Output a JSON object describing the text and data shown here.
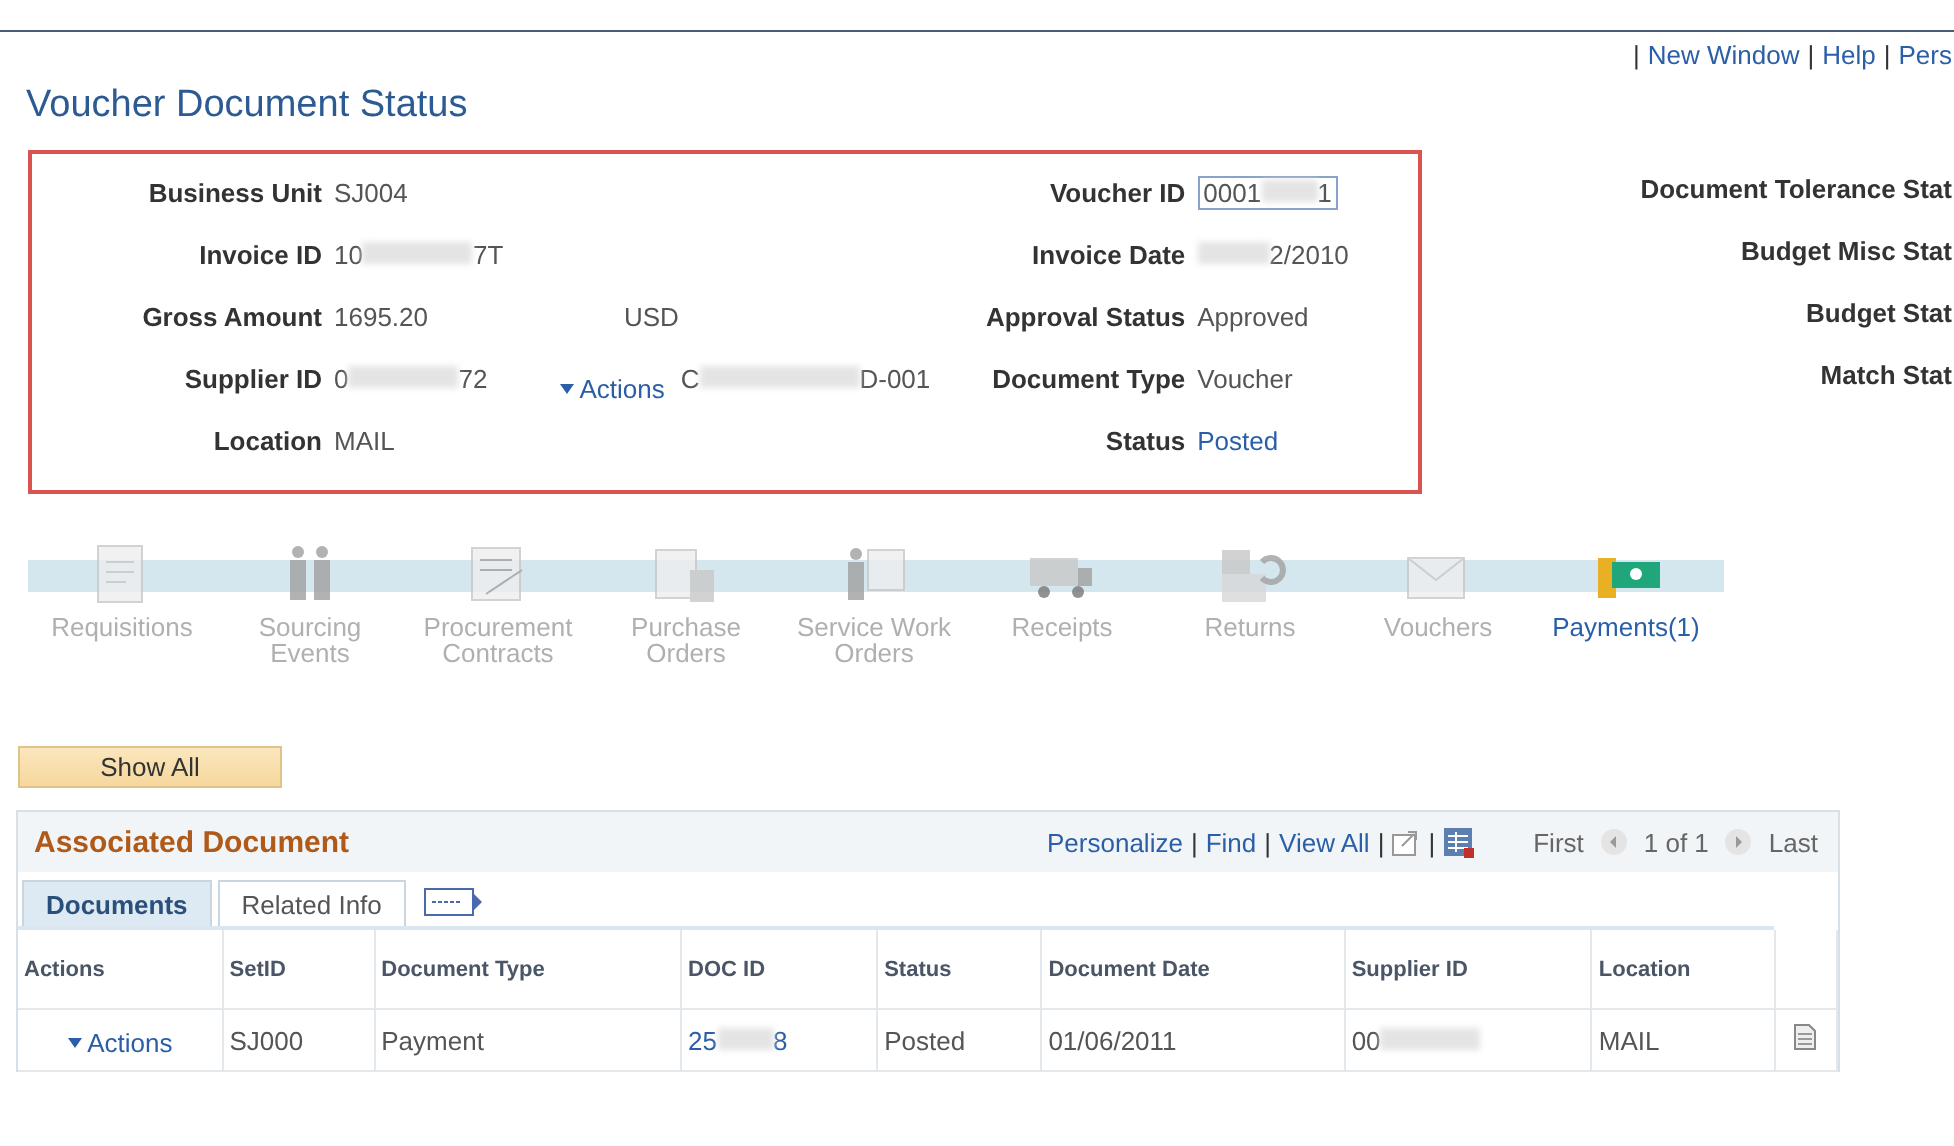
{
  "header_links": [
    "New Window",
    "Help",
    "Pers"
  ],
  "separator": "|",
  "title": "Voucher Document Status",
  "summary_left": [
    {
      "label": "Business Unit",
      "value": {
        "prefix": "SJ004"
      }
    },
    {
      "label": "Invoice ID",
      "value": {
        "prefix": "10",
        "suffix": "7T",
        "redacted": true
      }
    },
    {
      "label": "Gross Amount",
      "value": {
        "prefix": "1695.20"
      },
      "extra": {
        "prefix": "USD"
      }
    },
    {
      "label": "Supplier ID",
      "value": {
        "prefix": "0",
        "suffix": "72",
        "redacted": true
      },
      "action": "Actions",
      "extra": {
        "prefix": "C",
        "suffix": "D-001",
        "redacted": true
      }
    },
    {
      "label": "Location",
      "value": {
        "prefix": "MAIL"
      }
    }
  ],
  "summary_right": [
    {
      "label": "Voucher ID",
      "value": {
        "prefix": "0001",
        "suffix": "1",
        "redacted": true
      },
      "kind": "field"
    },
    {
      "label": "Invoice Date",
      "value": {
        "suffix": "2/2010",
        "redacted": true
      },
      "kind": "text"
    },
    {
      "label": "Approval Status",
      "value": {
        "prefix": "Approved"
      },
      "kind": "text"
    },
    {
      "label": "Document Type",
      "value": {
        "prefix": "Voucher"
      },
      "kind": "text"
    },
    {
      "label": "Status",
      "value": {
        "prefix": "Posted"
      },
      "kind": "link"
    }
  ],
  "status_labels": [
    "Document Tolerance Stat",
    "Budget Misc Stat",
    "Budget Stat",
    "Match Stat"
  ],
  "flow": [
    {
      "label": "Requisitions",
      "kind": "document",
      "active": false
    },
    {
      "label": "Sourcing Events",
      "kind": "people",
      "active": false
    },
    {
      "label": "Procurement Contracts",
      "kind": "contract",
      "active": false
    },
    {
      "label": "Purchase Orders",
      "kind": "orders",
      "active": false
    },
    {
      "label": "Service Work Orders",
      "kind": "worker",
      "active": false
    },
    {
      "label": "Receipts",
      "kind": "truck",
      "active": false
    },
    {
      "label": "Returns",
      "kind": "boxes",
      "active": false
    },
    {
      "label": "Vouchers",
      "kind": "envelope",
      "active": false
    },
    {
      "label": "Payments(1)",
      "kind": "money",
      "active": true
    }
  ],
  "show_all": "Show All",
  "grid": {
    "title": "Associated Document",
    "links": [
      "Personalize",
      "Find",
      "View All"
    ],
    "nav": {
      "first": "First",
      "count": "1 of 1",
      "last": "Last"
    },
    "tabs": [
      {
        "label": "Documents",
        "selected": true
      },
      {
        "label": "Related Info",
        "selected": false
      }
    ],
    "columns": [
      "Actions",
      "SetID",
      "Document Type",
      "DOC ID",
      "Status",
      "Document Date",
      "Supplier ID",
      "Location"
    ],
    "rows": [
      {
        "cells": [
          {
            "kind": "action",
            "value": {
              "prefix": "Actions"
            }
          },
          {
            "kind": "text",
            "value": {
              "prefix": "SJ000"
            }
          },
          {
            "kind": "text",
            "value": {
              "prefix": "Payment"
            }
          },
          {
            "kind": "link",
            "value": {
              "prefix": "25",
              "suffix": "8",
              "redacted": true
            }
          },
          {
            "kind": "text",
            "value": {
              "prefix": "Posted"
            }
          },
          {
            "kind": "text",
            "value": {
              "prefix": "01/06/2011"
            }
          },
          {
            "kind": "text",
            "value": {
              "prefix": "00",
              "redacted": true
            }
          },
          {
            "kind": "text",
            "value": {
              "prefix": "MAIL"
            }
          },
          {
            "kind": "doc"
          }
        ]
      }
    ]
  }
}
